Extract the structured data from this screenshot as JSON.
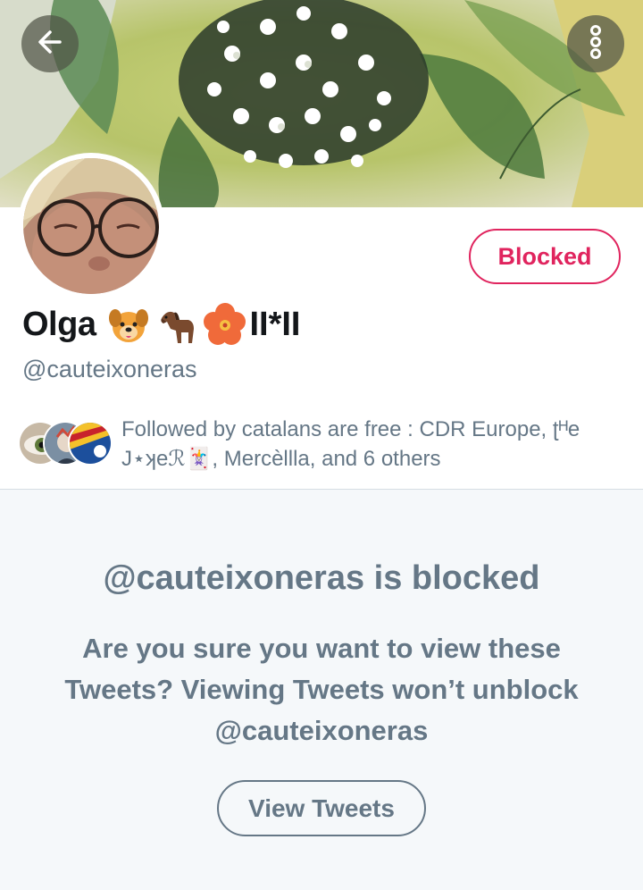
{
  "profile": {
    "name": "Olga",
    "name_suffix": "II*II",
    "name_emojis": [
      "dog-face-emoji",
      "horse-emoji",
      "hibiscus-emoji"
    ],
    "handle": "@cauteixoneras",
    "block_status_label": "Blocked"
  },
  "followed_by": {
    "text": "Followed by catalans are free : CDR Europe, ʈᴴe J⋆ʞeℛ🃏, Mercèllla, and 6 others",
    "avatars": [
      "eye-photo-avatar",
      "costume-photo-avatar",
      "flag-avatar"
    ]
  },
  "blocked_notice": {
    "title": "@cauteixoneras is blocked",
    "message": "Are you sure you want to view these Tweets? Viewing Tweets won’t unblock @cauteixoneras",
    "button_label": "View Tweets"
  },
  "icons": {
    "back": "arrow-left-icon",
    "more": "more-vertical-icon"
  },
  "colors": {
    "accent_blocked": "#e0245e",
    "secondary_text": "#657786",
    "primary_text": "#14171a",
    "background": "#f5f8fa"
  }
}
